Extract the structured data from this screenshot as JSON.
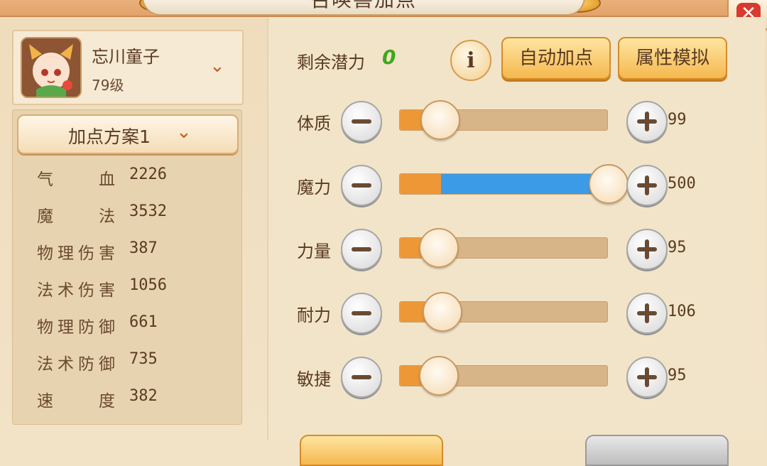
{
  "window": {
    "title": "召唤兽加点",
    "close_icon": "close-icon"
  },
  "character": {
    "name": "忘川童子",
    "level": "79级"
  },
  "plan": {
    "label": "加点方案1"
  },
  "stats": [
    {
      "label": "气血",
      "value": "2226"
    },
    {
      "label": "魔法",
      "value": "3532"
    },
    {
      "label": "物理伤害",
      "value": "387"
    },
    {
      "label": "法术伤害",
      "value": "1056"
    },
    {
      "label": "物理防御",
      "value": "661"
    },
    {
      "label": "法术防御",
      "value": "735"
    },
    {
      "label": "速度",
      "value": "382"
    }
  ],
  "potential": {
    "label": "剩余潜力",
    "value": "0"
  },
  "buttons": {
    "auto_assign": "自动加点",
    "simulate": "属性模拟",
    "info": "i"
  },
  "attributes": [
    {
      "label": "体质",
      "value": "99",
      "fill_fraction": 0.19,
      "blue_fraction": 0
    },
    {
      "label": "魔力",
      "value": "500",
      "fill_fraction": 1.0,
      "blue_fraction": 0.8
    },
    {
      "label": "力量",
      "value": "95",
      "fill_fraction": 0.18,
      "blue_fraction": 0
    },
    {
      "label": "耐力",
      "value": "106",
      "fill_fraction": 0.2,
      "blue_fraction": 0
    },
    {
      "label": "敏捷",
      "value": "95",
      "fill_fraction": 0.18,
      "blue_fraction": 0
    }
  ],
  "colors": {
    "slider_base": "#ee9737",
    "slider_added": "#3c9be6",
    "potential_value": "#3fa81c"
  }
}
